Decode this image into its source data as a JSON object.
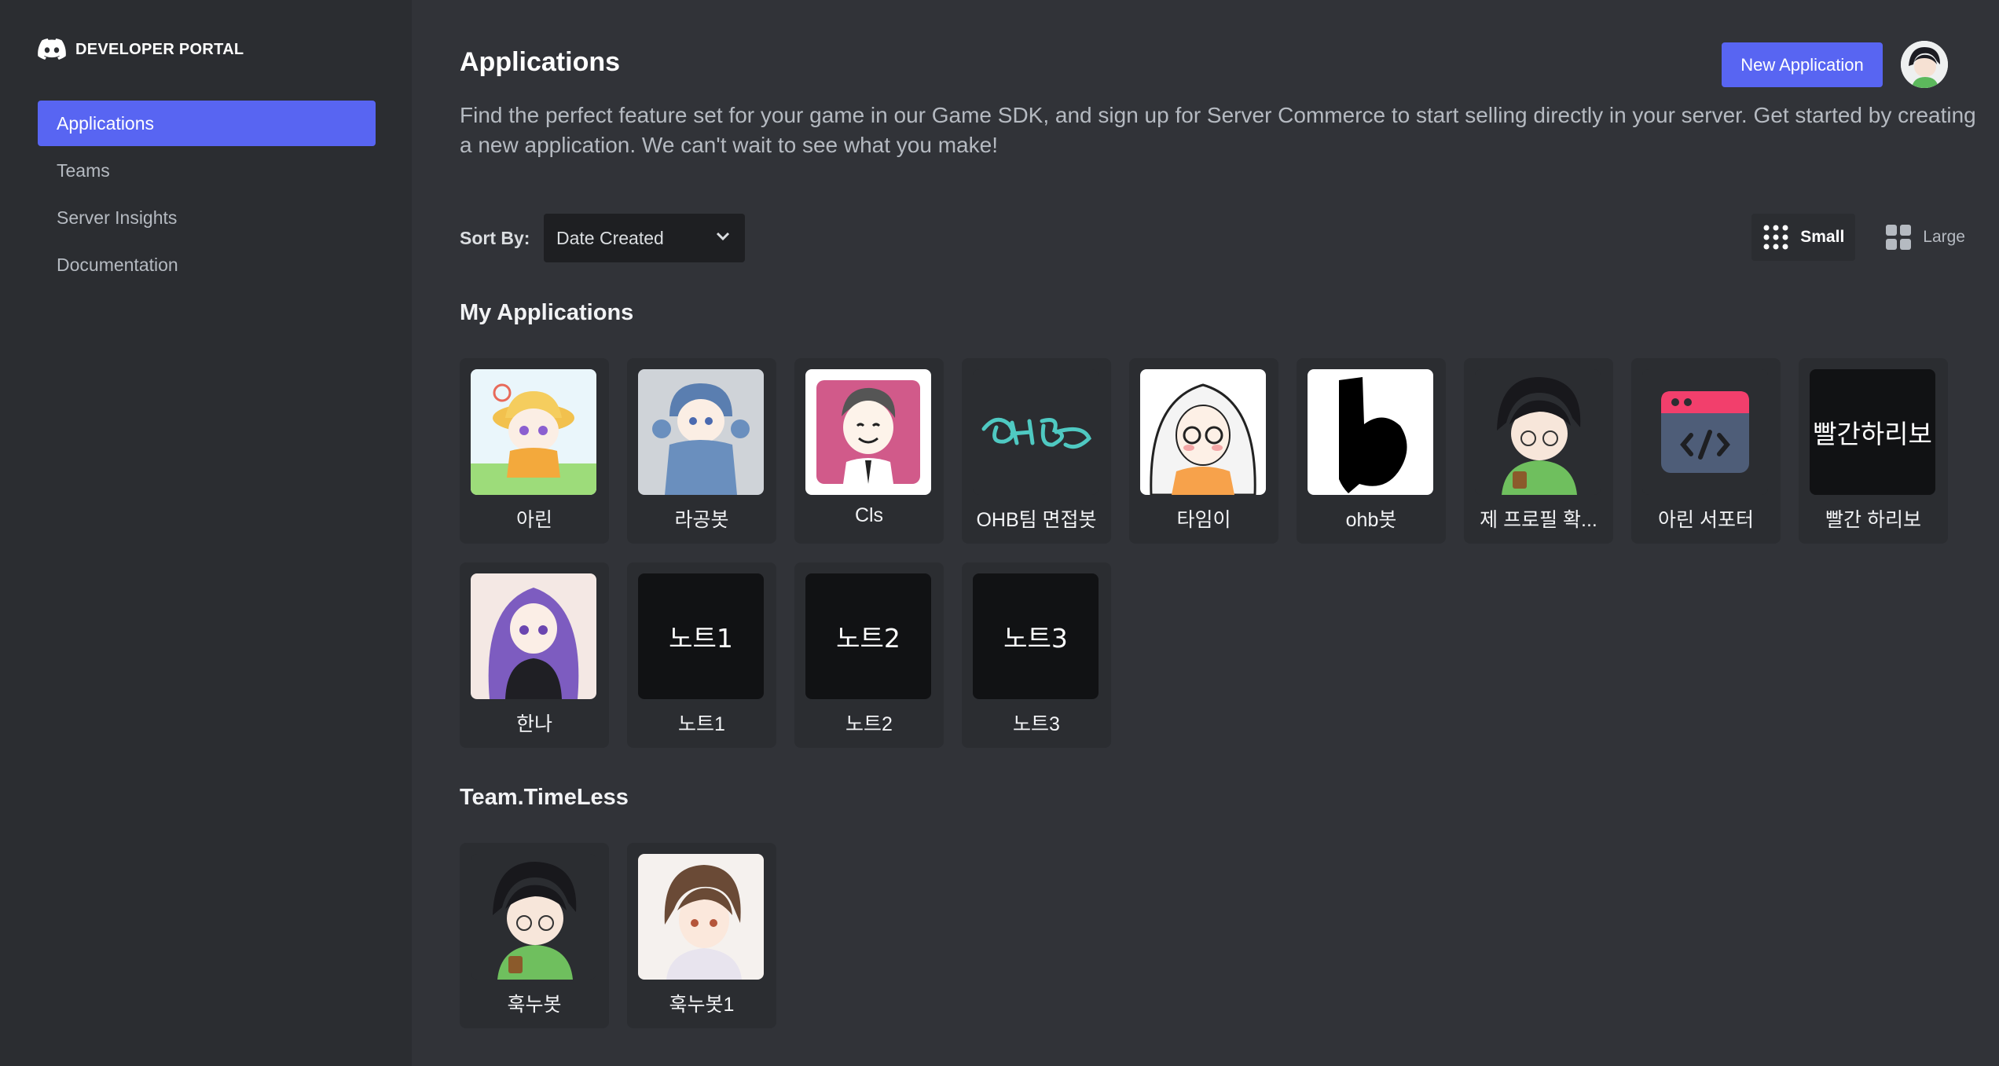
{
  "brand": {
    "text": "DEVELOPER PORTAL"
  },
  "sidebar": {
    "items": [
      {
        "label": "Applications",
        "active": true
      },
      {
        "label": "Teams"
      },
      {
        "label": "Server Insights"
      },
      {
        "label": "Documentation"
      }
    ]
  },
  "header": {
    "title": "Applications",
    "new_button": "New Application",
    "description": "Find the perfect feature set for your game in our Game SDK, and sign up for Server Commerce to start selling directly in your server. Get started by creating a new application. We can't wait to see what you make!"
  },
  "sort": {
    "label": "Sort By:",
    "value": "Date Created"
  },
  "view": {
    "small": "Small",
    "large": "Large",
    "selected": "Small"
  },
  "my_apps": {
    "title": "My Applications",
    "apps": [
      {
        "name": "아린",
        "icon": "girl-yellow-hat-icon"
      },
      {
        "name": "라공봇",
        "icon": "blue-hoodie-girl-icon"
      },
      {
        "name": "Cls",
        "icon": "smiling-man-icon"
      },
      {
        "name": "OHB팀 면접봇",
        "icon": "ohb-logo-icon"
      },
      {
        "name": "타임이",
        "icon": "white-hair-girl-icon"
      },
      {
        "name": "ohb봇",
        "icon": "letter-b-icon"
      },
      {
        "name": "제 프로필 확...",
        "icon": "green-hoodie-boy-icon"
      },
      {
        "name": "아린 서포터",
        "icon": "code-window-icon"
      },
      {
        "name": "빨간 하리보",
        "icon_text": "빨간하리보"
      },
      {
        "name": "한나",
        "icon": "purple-hair-girl-icon"
      },
      {
        "name": "노트1",
        "icon_text": "노트1"
      },
      {
        "name": "노트2",
        "icon_text": "노트2"
      },
      {
        "name": "노트3",
        "icon_text": "노트3"
      }
    ]
  },
  "team": {
    "title": "Team.TimeLess",
    "apps": [
      {
        "name": "훅누봇",
        "icon": "green-hoodie-boy-icon"
      },
      {
        "name": "훅누봇1",
        "icon": "brown-hair-boy-icon"
      }
    ]
  },
  "colors": {
    "accent": "#5865f2",
    "background": "#313338",
    "sidebar": "#2b2d31"
  }
}
